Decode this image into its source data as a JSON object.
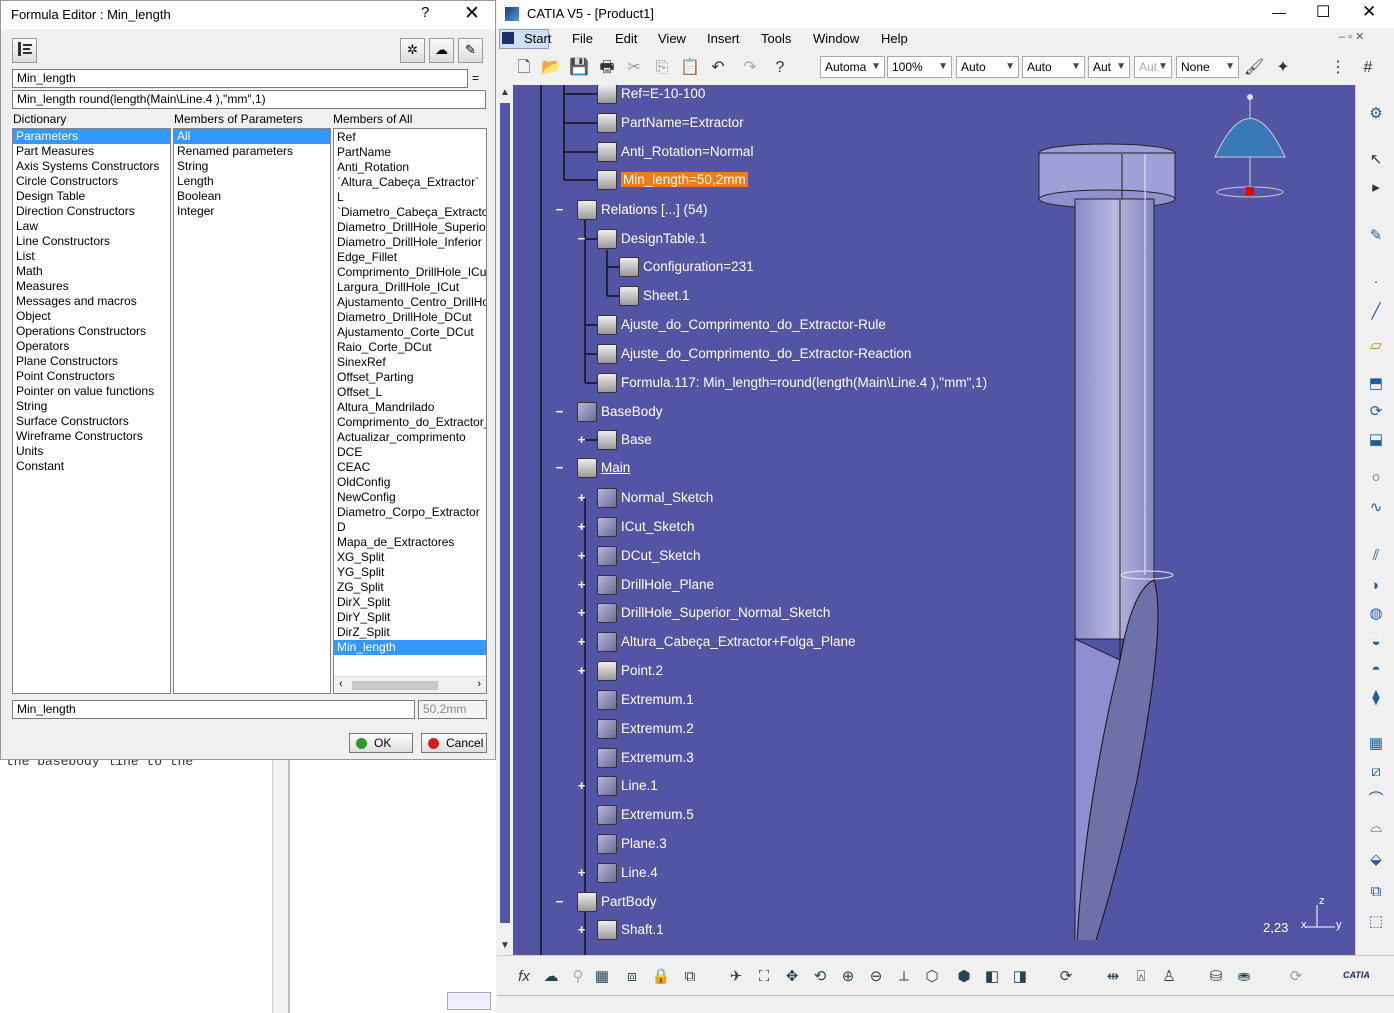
{
  "dialog": {
    "title": "Formula Editor : Min_length",
    "help": "?",
    "close": "✕",
    "param_name": "Min_length",
    "equals": "=",
    "formula": "Min_length round(length(Main\\Line.4 ),\"mm\",1)",
    "dictionary_label": "Dictionary",
    "members_params_label": "Members of Parameters",
    "members_all_label": "Members of All",
    "dictionary": [
      "Parameters",
      "Part Measures",
      "Axis Systems Constructors",
      "Circle Constructors",
      "Design Table",
      "Direction Constructors",
      "Law",
      "Line Constructors",
      "List",
      "Math",
      "Measures",
      "Messages and macros",
      "Object",
      "Operations Constructors",
      "Operators",
      "Plane Constructors",
      "Point Constructors",
      "Pointer on value functions",
      "String",
      "Surface Constructors",
      "Wireframe Constructors",
      "Units",
      "Constant"
    ],
    "members_params": [
      "All",
      "Renamed parameters",
      "String",
      "Length",
      "Boolean",
      "Integer"
    ],
    "members_all": [
      "Ref",
      "PartName",
      "Anti_Rotation",
      "`Altura_Cabeça_Extractor`",
      "L",
      "`Diametro_Cabeça_Extractor",
      "Diametro_DrillHole_Superio",
      "Diametro_DrillHole_Inferior",
      "Edge_Fillet",
      "Comprimento_DrillHole_ICu",
      "Largura_DrillHole_ICut",
      "Ajustamento_Centro_DrillHo",
      "Diametro_DrillHole_DCut",
      "Ajustamento_Corte_DCut",
      "Raio_Corte_DCut",
      "SinexRef",
      "Offset_Parting",
      "Offset_L",
      "Altura_Mandrilado",
      "Comprimento_do_Extractor_",
      "Actualizar_comprimento",
      "DCE",
      "CEAC",
      "OldConfig",
      "NewConfig",
      "Diametro_Corpo_Extractor",
      "D",
      "Mapa_de_Extractores",
      "XG_Split",
      "YG_Split",
      "ZG_Split",
      "DirX_Split",
      "DirY_Split",
      "DirZ_Split",
      "Min_length"
    ],
    "bottom_name": "Min_length",
    "bottom_value": "50,2mm",
    "ok": "OK",
    "cancel": "Cancel"
  },
  "background_doc": {
    "text": "the basebody line to the"
  },
  "catia": {
    "title": "CATIA V5 - [Product1]",
    "min": "—",
    "max": "☐",
    "close": "✕",
    "menu": [
      "Start",
      "File",
      "Edit",
      "View",
      "Insert",
      "Tools",
      "Window",
      "Help"
    ],
    "combos": [
      "Automa",
      "100%",
      "Auto",
      "Auto",
      "Aut",
      "Aut",
      "None"
    ],
    "coord": "2,23",
    "tree": [
      {
        "label": "Ref=E-10-100"
      },
      {
        "label": "PartName=Extractor"
      },
      {
        "label": "Anti_Rotation=Normal"
      },
      {
        "label": "Min_length=50,2mm"
      },
      {
        "label": "Relations [...] (54)"
      },
      {
        "label": "DesignTable.1"
      },
      {
        "label": "Configuration=231"
      },
      {
        "label": "Sheet.1"
      },
      {
        "label": "Ajuste_do_Comprimento_do_Extractor-Rule"
      },
      {
        "label": "Ajuste_do_Comprimento_do_Extractor-Reaction"
      },
      {
        "label": "Formula.117: Min_length=round(length(Main\\Line.4 ),\"mm\",1)"
      },
      {
        "label": "BaseBody"
      },
      {
        "label": "Base"
      },
      {
        "label": "Main"
      },
      {
        "label": "Normal_Sketch"
      },
      {
        "label": "ICut_Sketch"
      },
      {
        "label": "DCut_Sketch"
      },
      {
        "label": "DrillHole_Plane"
      },
      {
        "label": "DrillHole_Superior_Normal_Sketch"
      },
      {
        "label": "Altura_Cabeça_Extractor+Folga_Plane"
      },
      {
        "label": "Point.2"
      },
      {
        "label": "Extremum.1"
      },
      {
        "label": "Extremum.2"
      },
      {
        "label": "Extremum.3"
      },
      {
        "label": "Line.1"
      },
      {
        "label": "Extremum.5"
      },
      {
        "label": "Plane.3"
      },
      {
        "label": "Line.4"
      },
      {
        "label": "PartBody"
      },
      {
        "label": "Shaft.1"
      }
    ],
    "axis": {
      "x": "x",
      "y": "y",
      "z": "z"
    },
    "logo": "CATIA"
  }
}
